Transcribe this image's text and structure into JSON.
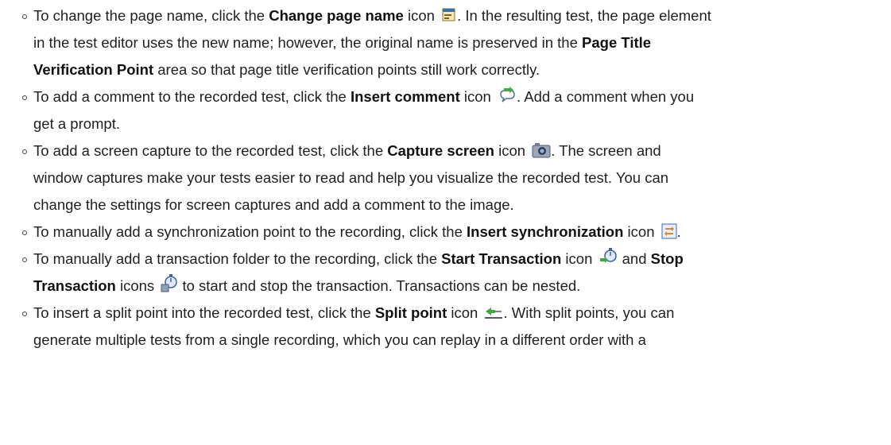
{
  "items": [
    {
      "a": "To change the page name, click the ",
      "b1": "Change page name",
      "c": " icon ",
      "icon": "change-page-name-icon",
      "d": ". In the resulting test, the page element",
      "l2": "in the test editor uses the new name; however, the original name is preserved in the ",
      "b2": "Page Title",
      "l3b": "Verification Point",
      "l3": " area so that page title verification points still work correctly."
    },
    {
      "a": "To add a comment to the recorded test, click the ",
      "b1": "Insert comment",
      "c": " icon ",
      "icon": "insert-comment-icon",
      "d": ". Add a comment when you",
      "l2": "get a prompt."
    },
    {
      "a": "To add a screen capture to the recorded test, click the ",
      "b1": "Capture screen",
      "c": " icon ",
      "icon": "camera-icon",
      "d": ". The screen and",
      "l2": "window captures make your tests easier to read and help you visualize the recorded test. You can",
      "l3": "change the settings for screen captures and add a comment to the image."
    },
    {
      "a": "To manually add a synchronization point to the recording, click the ",
      "b1": "Insert synchronization",
      "c": " icon ",
      "icon": "insert-synchronization-icon",
      "d": "."
    },
    {
      "a": "To manually add a transaction folder to the recording, click the ",
      "b1": "Start Transaction",
      "c": " icon ",
      "icon": "start-transaction-icon",
      "d": " and ",
      "b2": "Stop",
      "l2b": "Transaction",
      "l2c": " icons ",
      "icon2": "stop-transaction-icon",
      "l2d": " to start and stop the transaction. Transactions can be nested."
    },
    {
      "a": "To insert a split point into the recorded test, click the  ",
      "b1": "Split point",
      "c": " icon ",
      "icon": "split-point-icon",
      "d": ". With split points, you can",
      "l2": "generate multiple tests from a single recording, which you can replay in a different order with a"
    }
  ]
}
